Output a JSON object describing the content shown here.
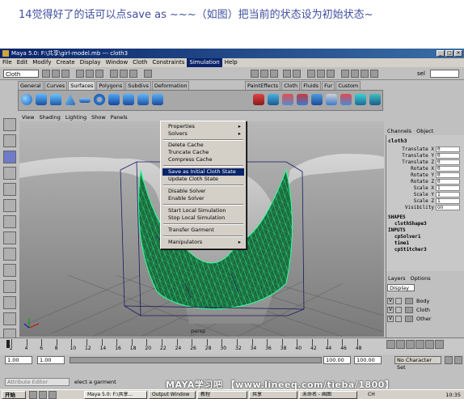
{
  "caption": "14觉得好了的话可以点save as ~~~（如图）把当前的状态设为初始状态~",
  "window": {
    "title": "Maya 5.0: F:\\共享\\girl-model.mb  ---  cloth3",
    "buttons": [
      "_",
      "□",
      "×"
    ]
  },
  "menubar": {
    "items": [
      "File",
      "Edit",
      "Modify",
      "Create",
      "Display",
      "Window",
      "Cloth",
      "Constraints",
      "Simulation",
      "Help"
    ]
  },
  "statusline": {
    "mode": "Cloth",
    "field": "sel"
  },
  "shelf": {
    "tabs": [
      "General",
      "Curves",
      "Surfaces",
      "Polygons",
      "Subdivs",
      "Deformation"
    ],
    "active_tab": "Surfaces",
    "tabs_right": [
      "PaintEffects",
      "Cloth",
      "Fluids",
      "Fur",
      "Custom"
    ]
  },
  "viewport": {
    "menu": [
      "View",
      "Shading",
      "Lighting",
      "Show",
      "Panels"
    ],
    "camera": "persp"
  },
  "simulation_menu": {
    "groups": [
      [
        {
          "label": "Properties",
          "submenu": true
        },
        {
          "label": "Solvers",
          "submenu": true
        }
      ],
      [
        {
          "label": "Delete Cache"
        },
        {
          "label": "Truncate Cache"
        },
        {
          "label": "Compress Cache"
        }
      ],
      [
        {
          "label": "Save as Initial Cloth State",
          "highlighted": true
        },
        {
          "label": "Update Cloth State"
        }
      ],
      [
        {
          "label": "Disable Solver"
        },
        {
          "label": "Enable Solver"
        }
      ],
      [
        {
          "label": "Start Local Simulation"
        },
        {
          "label": "Stop Local Simulation"
        }
      ],
      [
        {
          "label": "Transfer Garment"
        }
      ],
      [
        {
          "label": "Manipulators",
          "submenu": true
        }
      ]
    ]
  },
  "channel_box": {
    "header": [
      "Channels",
      "Object"
    ],
    "object": "cloth3",
    "attributes": [
      {
        "name": "Translate X",
        "value": "0"
      },
      {
        "name": "Translate Y",
        "value": "0"
      },
      {
        "name": "Translate Z",
        "value": "0"
      },
      {
        "name": "Rotate X",
        "value": "0"
      },
      {
        "name": "Rotate Y",
        "value": "0"
      },
      {
        "name": "Rotate Z",
        "value": "0"
      },
      {
        "name": "Scale X",
        "value": "1"
      },
      {
        "name": "Scale Y",
        "value": "1"
      },
      {
        "name": "Scale Z",
        "value": "1"
      },
      {
        "name": "Visibility",
        "value": "on"
      }
    ],
    "shapes_label": "SHAPES",
    "shapes": [
      "clothShape3"
    ],
    "inputs_label": "INPUTS",
    "inputs": [
      "cpSolver1",
      "time1",
      "cpStitcher3"
    ]
  },
  "layers": {
    "header": [
      "Layers",
      "Options"
    ],
    "mode": "Display",
    "items": [
      {
        "v": "V",
        "name": "Body"
      },
      {
        "v": "V",
        "name": "Cloth"
      },
      {
        "v": "V",
        "name": "Other"
      }
    ]
  },
  "timeslider": {
    "ticks": [
      "2",
      "4",
      "6",
      "8",
      "10",
      "12",
      "14",
      "16",
      "18",
      "20",
      "22",
      "24",
      "26",
      "28",
      "30",
      "32",
      "34",
      "36",
      "38",
      "40",
      "42",
      "44",
      "46",
      "48"
    ]
  },
  "range": {
    "start": "1.00",
    "current": "1.00",
    "end": "100.00",
    "end2": "100.00",
    "character": "No Character Set"
  },
  "command_line": {
    "label": "Attribute Editor",
    "text": "elect a garment"
  },
  "taskbar": {
    "start": "开始",
    "items": [
      "Maya 5.0: F:\\共享...",
      "Output Window",
      "教程",
      "共享",
      "未命名 - 画图"
    ],
    "tray": "CH",
    "clock": "10:35"
  },
  "watermark": "MAYA学习吧 【www.lineeq.com/tieba/1800】"
}
